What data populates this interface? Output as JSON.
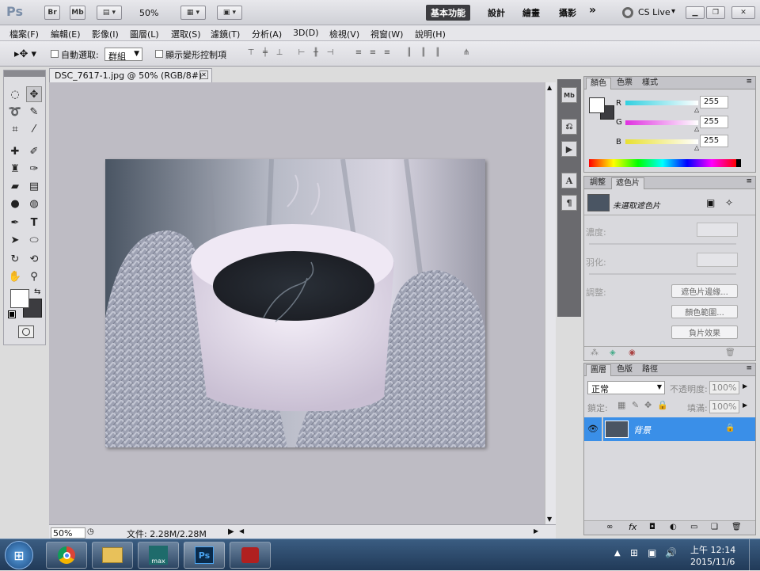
{
  "appbar": {
    "logo": "Ps",
    "br_label": "Br",
    "mb_label": "Mb",
    "zoom": "50%",
    "workspaces": [
      "基本功能",
      "設計",
      "繪畫",
      "攝影"
    ],
    "more": "»",
    "cs_live": "CS Live",
    "cs_live_arrow": "▾"
  },
  "menu": [
    "檔案(F)",
    "編輯(E)",
    "影像(I)",
    "圖層(L)",
    "選取(S)",
    "濾鏡(T)",
    "分析(A)",
    "3D(D)",
    "檢視(V)",
    "視窗(W)",
    "說明(H)"
  ],
  "options": {
    "auto_select_label": "自動選取:",
    "auto_select_value": "群組",
    "show_transform_label": "顯示變形控制項"
  },
  "document": {
    "tab_title": "DSC_7617-1.jpg @ 50% (RGB/8#) *",
    "zoom": "50%",
    "file_info": "文件: 2.28M/2.28M"
  },
  "color_panel": {
    "tabs": [
      "顏色",
      "色票",
      "樣式"
    ],
    "channels": [
      {
        "name": "R",
        "value": "255",
        "color": "#30d0e0"
      },
      {
        "name": "G",
        "value": "255",
        "color": "#e030e0"
      },
      {
        "name": "B",
        "value": "255",
        "color": "#e8e030"
      }
    ]
  },
  "masks_panel": {
    "tabs": [
      "調整",
      "遮色片"
    ],
    "status": "未選取遮色片",
    "density_label": "濃度:",
    "feather_label": "羽化:",
    "refine_label": "調整:",
    "btn_mask_edge": "遮色片邊緣...",
    "btn_color_range": "顏色範圍...",
    "btn_invert": "負片效果"
  },
  "layers_panel": {
    "tabs": [
      "圖層",
      "色版",
      "路徑"
    ],
    "blend_mode": "正常",
    "opacity_label": "不透明度:",
    "opacity_value": "100%",
    "lock_label": "鎖定:",
    "fill_label": "填滿:",
    "fill_value": "100%",
    "layer_name": "背景"
  },
  "taskbar": {
    "time": "上午 12:14",
    "date": "2015/11/6",
    "ps_label": "Ps",
    "max_label": "max"
  },
  "colors": {
    "accent_selected": "#3a8fe8",
    "taskbar": "#2c4a6e"
  }
}
